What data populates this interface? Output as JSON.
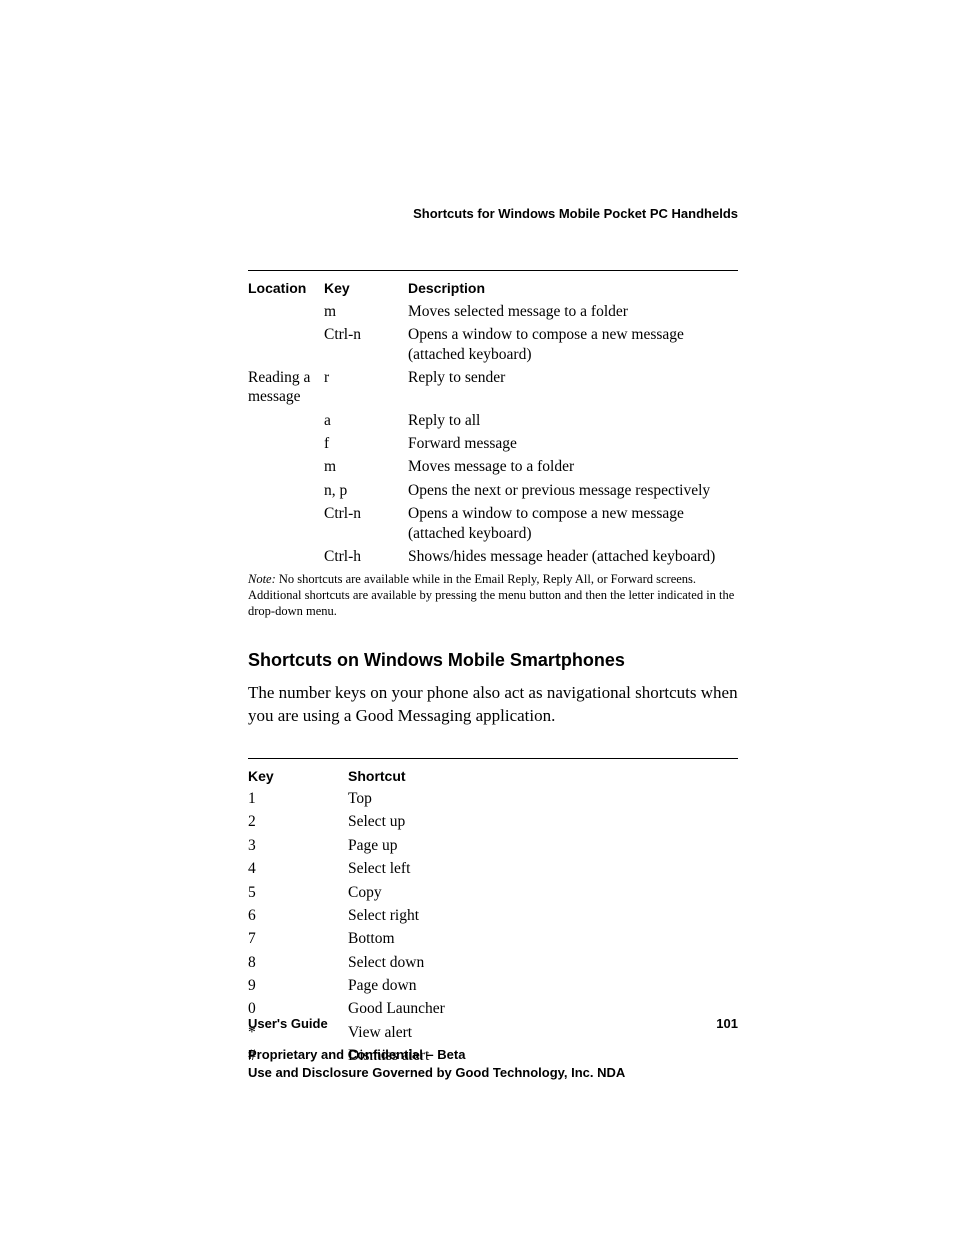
{
  "runningHead": "Shortcuts for Windows Mobile Pocket PC Handhelds",
  "table1": {
    "headers": {
      "c0": "Location",
      "c1": "Key",
      "c2": "Description"
    },
    "rows": [
      {
        "c0": "",
        "c1": "m",
        "c2": "Moves selected message to a folder"
      },
      {
        "c0": "",
        "c1": "Ctrl-n",
        "c2": "Opens a window to compose a new message (attached keyboard)"
      },
      {
        "c0": "Reading a message",
        "c1": "r",
        "c2": "Reply to sender"
      },
      {
        "c0": "",
        "c1": "a",
        "c2": "Reply to all"
      },
      {
        "c0": "",
        "c1": "f",
        "c2": "Forward message"
      },
      {
        "c0": "",
        "c1": "m",
        "c2": "Moves message to a folder"
      },
      {
        "c0": "",
        "c1": "n, p",
        "c2": "Opens the next or previous message respectively"
      },
      {
        "c0": "",
        "c1": "Ctrl-n",
        "c2": "Opens a window to compose a new message (attached keyboard)"
      },
      {
        "c0": "",
        "c1": "Ctrl-h",
        "c2": "Shows/hides message header (attached keyboard)"
      }
    ]
  },
  "note": {
    "label": "Note:",
    "text": " No shortcuts are available while in the Email Reply, Reply All, or Forward screens. Additional shortcuts are available by pressing the menu button and then the letter indicated in the drop-down menu."
  },
  "h2": "Shortcuts on Windows Mobile Smartphones",
  "para": "The number keys on your phone also act as navigational shortcuts when you are using a Good Messaging application.",
  "table2": {
    "headers": {
      "c0": "Key",
      "c1": "Shortcut"
    },
    "rows": [
      {
        "c0": "1",
        "c1": "Top"
      },
      {
        "c0": "2",
        "c1": "Select up"
      },
      {
        "c0": "3",
        "c1": "Page up"
      },
      {
        "c0": "4",
        "c1": "Select left"
      },
      {
        "c0": "5",
        "c1": "Copy"
      },
      {
        "c0": "6",
        "c1": "Select right"
      },
      {
        "c0": "7",
        "c1": "Bottom"
      },
      {
        "c0": "8",
        "c1": "Select down"
      },
      {
        "c0": "9",
        "c1": "Page down"
      },
      {
        "c0": "0",
        "c1": "Good Launcher"
      },
      {
        "c0": "*",
        "c1": "View alert"
      },
      {
        "c0": "#",
        "c1": "Dismiss alert"
      }
    ]
  },
  "footer": {
    "left": "User's Guide",
    "right": "101",
    "line1": "Proprietary and Confidential – Beta",
    "line2": "Use and Disclosure Governed by Good Technology, Inc. NDA"
  }
}
